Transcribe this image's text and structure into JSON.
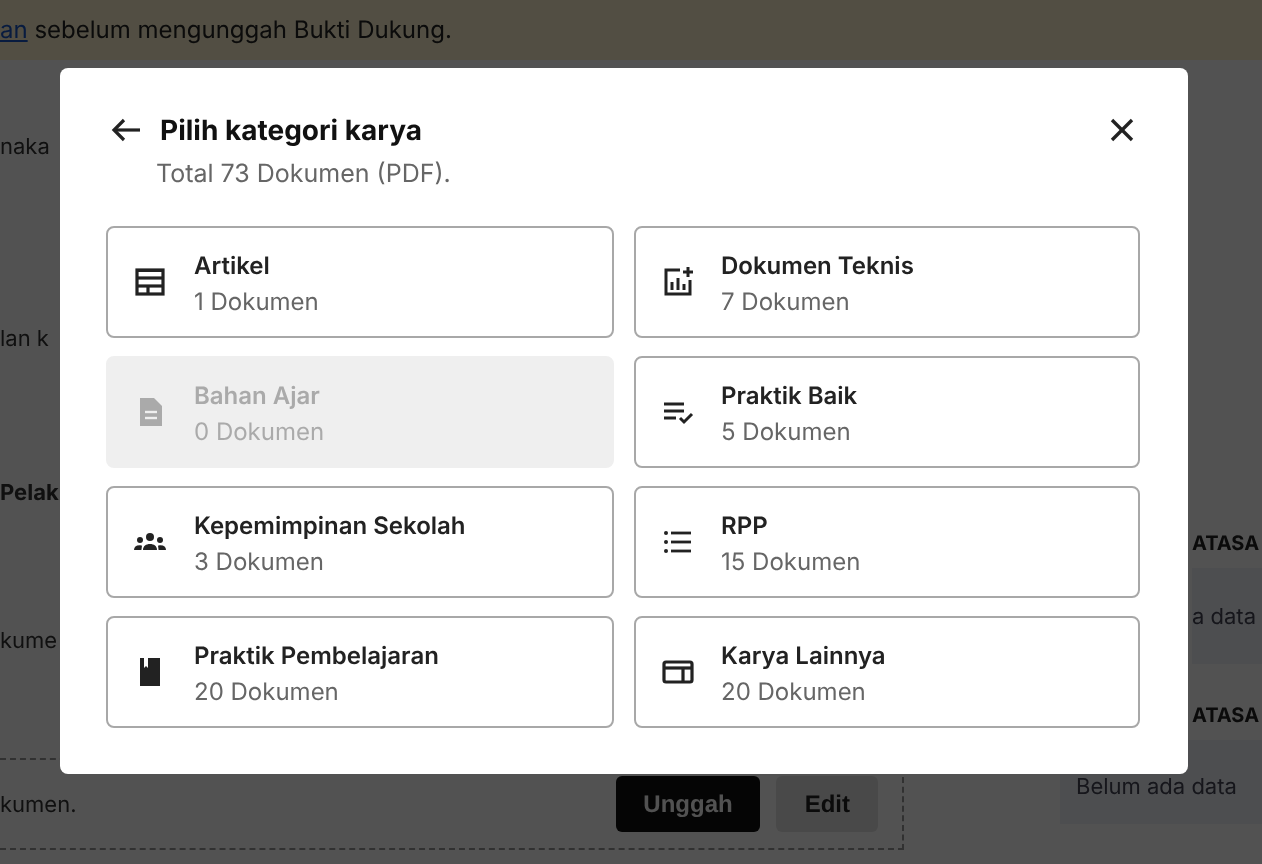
{
  "background": {
    "banner": {
      "link": "an",
      "text": "sebelum mengunggah Bukti Dukung."
    },
    "left_fragments": [
      {
        "text": "naka",
        "bold": false
      },
      {
        "text": "lan k",
        "bold": false
      },
      {
        "text": "Pelak",
        "bold": true
      },
      {
        "text": "kume",
        "bold": false
      }
    ],
    "right_fragments": [
      {
        "heading": "ATASA",
        "box_text": "a data"
      },
      {
        "heading": "ATASA",
        "box_text": "Belum ada data"
      }
    ],
    "upload": {
      "text": "kumen.",
      "buttons": [
        {
          "label": "Unggah",
          "disabled": false
        },
        {
          "label": "Edit",
          "disabled": true
        }
      ]
    }
  },
  "dialog": {
    "title": "Pilih kategori karya",
    "subtitle": "Total 73 Dokumen (PDF).",
    "categories": [
      {
        "kind": "article",
        "name": "Artikel",
        "count": "1 Dokumen",
        "disabled": false
      },
      {
        "kind": "technical",
        "name": "Dokumen Teknis",
        "count": "7 Dokumen",
        "disabled": false
      },
      {
        "kind": "material",
        "name": "Bahan Ajar",
        "count": "0 Dokumen",
        "disabled": true
      },
      {
        "kind": "practice",
        "name": "Praktik Baik",
        "count": "5 Dokumen",
        "disabled": false
      },
      {
        "kind": "leadership",
        "name": "Kepemimpinan Sekolah",
        "count": "3 Dokumen",
        "disabled": false
      },
      {
        "kind": "plan",
        "name": "RPP",
        "count": "15 Dokumen",
        "disabled": false
      },
      {
        "kind": "learning",
        "name": "Praktik Pembelajaran",
        "count": "20 Dokumen",
        "disabled": false
      },
      {
        "kind": "other",
        "name": "Karya Lainnya",
        "count": "20 Dokumen",
        "disabled": false
      }
    ]
  }
}
